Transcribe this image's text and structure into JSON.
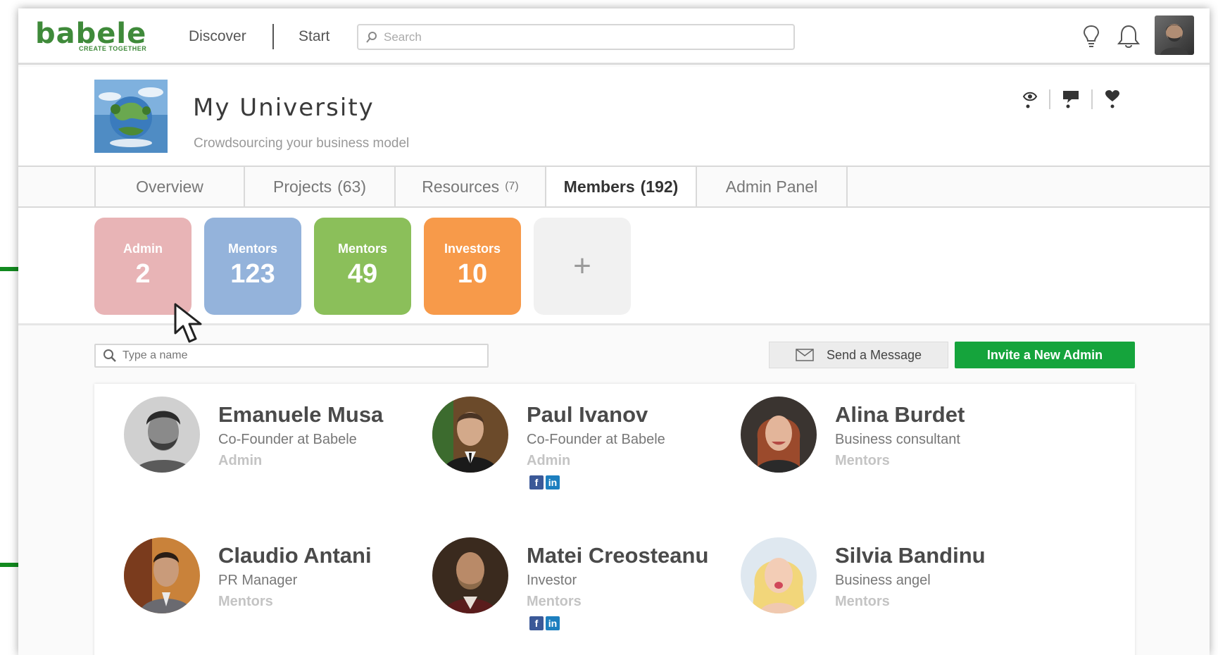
{
  "topnav": {
    "logo": {
      "word": "babele",
      "tagline": "CREATE TOGETHER"
    },
    "links": [
      "Discover",
      "Start"
    ],
    "search_placeholder": "Search",
    "icons": [
      "lightbulb-icon",
      "bell-icon"
    ]
  },
  "org": {
    "title": "My University",
    "subtitle": "Crowdsourcing your business model",
    "actions": [
      "eye-icon",
      "comment-icon",
      "heart-icon"
    ]
  },
  "tabs": [
    {
      "label": "Overview",
      "count": ""
    },
    {
      "label": "Projects",
      "count": "(63)"
    },
    {
      "label": "Resources",
      "count": "(7)"
    },
    {
      "label": "Members",
      "count": "(192)",
      "active": true
    },
    {
      "label": "Admin Panel",
      "count": ""
    }
  ],
  "role_cards": [
    {
      "label": "Admin",
      "count": "2",
      "color": "#e8b4b6"
    },
    {
      "label": "Mentors",
      "count": "123",
      "color": "#94b3db"
    },
    {
      "label": "Mentors",
      "count": "49",
      "color": "#8bbf5a"
    },
    {
      "label": "Investors",
      "count": "10",
      "color": "#f79a4a"
    }
  ],
  "add_card_label": "+",
  "filter": {
    "placeholder": "Type a name"
  },
  "buttons": {
    "send_message": "Send a Message",
    "invite_admin": "Invite a New Admin"
  },
  "members": [
    {
      "name": "Emanuele Musa",
      "title": "Co-Founder at Babele",
      "role": "Admin",
      "social": false
    },
    {
      "name": "Paul Ivanov",
      "title": "Co-Founder at Babele",
      "role": "Admin",
      "social": true
    },
    {
      "name": "Alina Burdet",
      "title": "Business consultant",
      "role": "Mentors",
      "social": false
    },
    {
      "name": "Claudio Antani",
      "title": "PR Manager",
      "role": "Mentors",
      "social": false
    },
    {
      "name": "Matei Creosteanu",
      "title": "Investor",
      "role": "Mentors",
      "social": true
    },
    {
      "name": "Silvia Bandinu",
      "title": "Business angel",
      "role": "Mentors",
      "social": false
    }
  ],
  "social_labels": {
    "facebook": "f",
    "linkedin": "in"
  },
  "colors": {
    "brand_green": "#3f8a3a",
    "invite_green": "#15a43c",
    "marker_green": "#128a1f"
  }
}
